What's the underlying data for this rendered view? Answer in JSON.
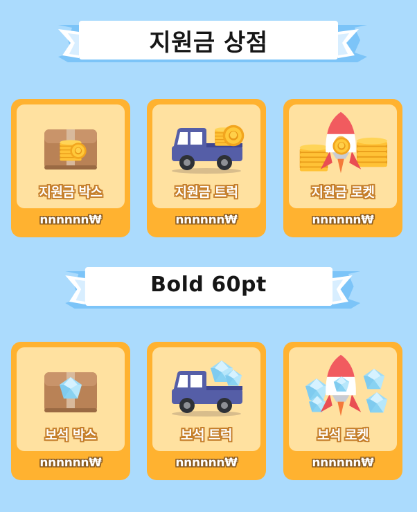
{
  "colors": {
    "background": "#ABDBFD",
    "ribbon_front": "#FFFFFF",
    "ribbon_back": "#7CC4F8",
    "card_frame": "#FFB230",
    "card_inner": "#FFE1A0"
  },
  "sections": [
    {
      "title": "지원금 상점",
      "items": [
        {
          "name": "지원금 박스",
          "price": "nnnnnn₩",
          "icon": "coin-box-icon"
        },
        {
          "name": "지원금 트럭",
          "price": "nnnnnn₩",
          "icon": "coin-truck-icon"
        },
        {
          "name": "지원금 로켓",
          "price": "nnnnnn₩",
          "icon": "coin-rocket-icon"
        }
      ]
    },
    {
      "title": "Bold 60pt",
      "items": [
        {
          "name": "보석 박스",
          "price": "nnnnnn₩",
          "icon": "gem-box-icon"
        },
        {
          "name": "보석 트럭",
          "price": "nnnnnn₩",
          "icon": "gem-truck-icon"
        },
        {
          "name": "보석 로켓",
          "price": "nnnnnn₩",
          "icon": "gem-rocket-icon"
        }
      ]
    }
  ]
}
